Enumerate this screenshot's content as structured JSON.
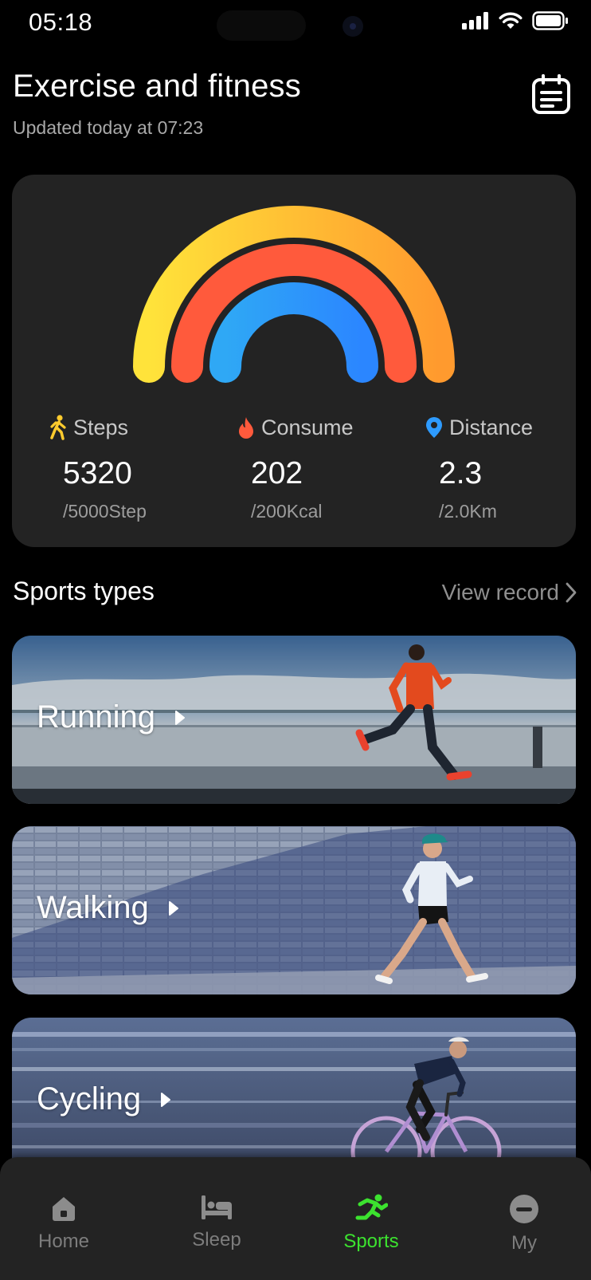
{
  "status_bar": {
    "time": "05:18"
  },
  "header": {
    "title": "Exercise and fitness",
    "updated": "Updated today at 07:23"
  },
  "summary": {
    "arcs": [
      {
        "name": "Steps",
        "progress": 1.0,
        "color_start": "#FFE33A",
        "color_end": "#FF9A2E"
      },
      {
        "name": "Consume",
        "progress": 1.0,
        "color": "#FF5A3C"
      },
      {
        "name": "Distance",
        "progress": 1.0,
        "color_start": "#2FA8F5",
        "color_end": "#2B86FF"
      }
    ],
    "metrics": [
      {
        "icon": "walking-person-icon",
        "label": "Steps",
        "value": "5320",
        "goal": "/5000Step",
        "color": "#FFCB2E"
      },
      {
        "icon": "flame-icon",
        "label": "Consume",
        "value": "202",
        "goal": "/200Kcal",
        "color": "#FF5A3C"
      },
      {
        "icon": "location-pin-icon",
        "label": "Distance",
        "value": "2.3",
        "goal": "/2.0Km",
        "color": "#2E9BFF"
      }
    ]
  },
  "sports": {
    "title": "Sports types",
    "view_record": "View record",
    "items": [
      {
        "name": "Running"
      },
      {
        "name": "Walking"
      },
      {
        "name": "Cycling"
      }
    ]
  },
  "nav": {
    "items": [
      {
        "label": "Home",
        "icon": "home-icon"
      },
      {
        "label": "Sleep",
        "icon": "bed-icon"
      },
      {
        "label": "Sports",
        "icon": "sports-runner-icon",
        "active": true
      },
      {
        "label": "My",
        "icon": "profile-icon"
      }
    ],
    "active_color": "#3CE22F"
  }
}
